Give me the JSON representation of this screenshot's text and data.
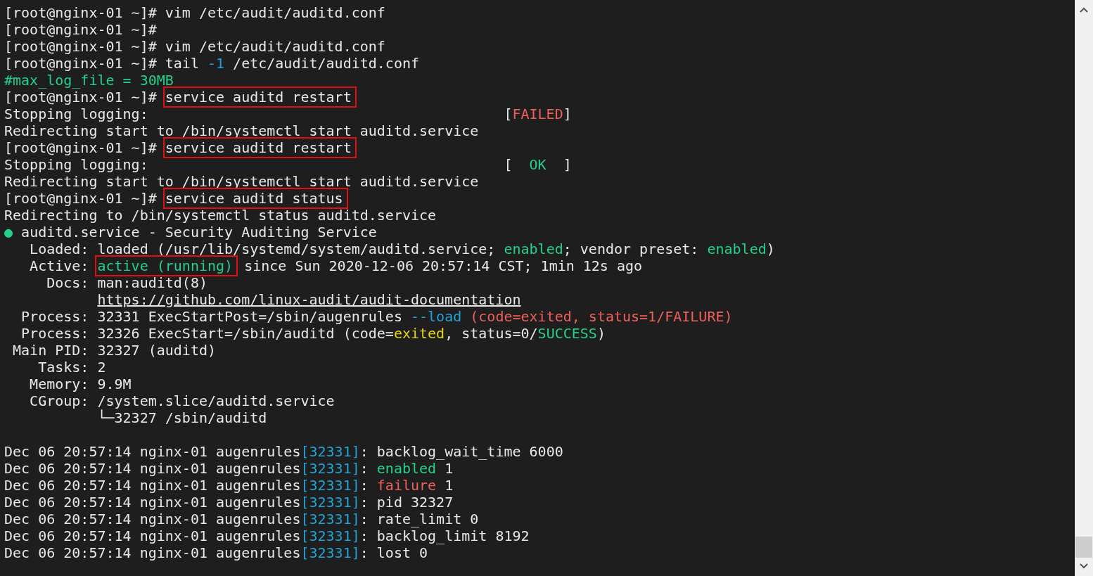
{
  "terminal": {
    "lines": [
      {
        "kind": "text",
        "segments": [
          {
            "text": "[root@nginx-01 ~]# vim /etc/audit/auditd.conf",
            "kind": "plain",
            "boxed": false
          }
        ]
      },
      {
        "kind": "text",
        "segments": [
          {
            "text": "[root@nginx-01 ~]#",
            "kind": "plain",
            "boxed": false
          }
        ]
      },
      {
        "kind": "text",
        "segments": [
          {
            "text": "[root@nginx-01 ~]# vim /etc/audit/auditd.conf",
            "kind": "plain",
            "boxed": false
          }
        ]
      },
      {
        "kind": "text",
        "segments": [
          {
            "text": "[root@nginx-01 ~]# tail ",
            "kind": "plain",
            "boxed": false
          },
          {
            "text": "-1",
            "kind": "option",
            "boxed": false
          },
          {
            "text": " /etc/audit/auditd.conf",
            "kind": "plain",
            "boxed": false
          }
        ]
      },
      {
        "kind": "text",
        "segments": [
          {
            "text": "#max_log_file = 30MB",
            "kind": "comment",
            "boxed": false
          }
        ]
      },
      {
        "kind": "text",
        "segments": [
          {
            "text": "[root@nginx-01 ~]# ",
            "kind": "plain",
            "boxed": false
          },
          {
            "text": "service auditd restart",
            "kind": "plain",
            "boxed": true
          }
        ]
      },
      {
        "kind": "status",
        "segments": [
          {
            "text": "Stopping logging:",
            "kind": "plain",
            "boxed": false
          }
        ],
        "status": {
          "open": "[",
          "label": "FAILED",
          "close": "]",
          "color": "#f0605a"
        }
      },
      {
        "kind": "text",
        "segments": [
          {
            "text": "Redirecting start to /bin/systemctl start auditd.service",
            "kind": "plain",
            "boxed": false
          }
        ]
      },
      {
        "kind": "text",
        "segments": [
          {
            "text": "[root@nginx-01 ~]# ",
            "kind": "plain",
            "boxed": false
          },
          {
            "text": "service auditd restart",
            "kind": "plain",
            "boxed": true
          }
        ]
      },
      {
        "kind": "status",
        "segments": [
          {
            "text": "Stopping logging:",
            "kind": "plain",
            "boxed": false
          }
        ],
        "status": {
          "open": "[",
          "label": "OK",
          "close": "]",
          "color": "#23d18b"
        }
      },
      {
        "kind": "text",
        "segments": [
          {
            "text": "Redirecting start to /bin/systemctl start auditd.service",
            "kind": "plain",
            "boxed": false
          }
        ]
      },
      {
        "kind": "text",
        "segments": [
          {
            "text": "[root@nginx-01 ~]# ",
            "kind": "plain",
            "boxed": false
          },
          {
            "text": "service auditd status",
            "kind": "plain",
            "boxed": true
          }
        ]
      },
      {
        "kind": "text",
        "segments": [
          {
            "text": "Redirecting to /bin/systemctl status auditd.service",
            "kind": "plain",
            "boxed": false
          }
        ]
      },
      {
        "kind": "text",
        "segments": [
          {
            "text": "●",
            "kind": "good",
            "boxed": false
          },
          {
            "text": " auditd.service - Security Auditing Service",
            "kind": "plain",
            "boxed": false
          }
        ]
      },
      {
        "kind": "text",
        "segments": [
          {
            "text": "   Loaded: loaded (/usr/lib/systemd/system/auditd.service; ",
            "kind": "plain",
            "boxed": false
          },
          {
            "text": "enabled",
            "kind": "good",
            "boxed": false
          },
          {
            "text": "; vendor preset: ",
            "kind": "plain",
            "boxed": false
          },
          {
            "text": "enabled",
            "kind": "good",
            "boxed": false
          },
          {
            "text": ")",
            "kind": "plain",
            "boxed": false
          }
        ]
      },
      {
        "kind": "text",
        "segments": [
          {
            "text": "   Active: ",
            "kind": "plain",
            "boxed": false
          },
          {
            "text": "active (running)",
            "kind": "good",
            "boxed": true
          },
          {
            "text": " since Sun 2020-12-06 20:57:14 CST; 1min 12s ago",
            "kind": "plain",
            "boxed": false
          }
        ]
      },
      {
        "kind": "text",
        "segments": [
          {
            "text": "     Docs: man:auditd(8)",
            "kind": "plain",
            "boxed": false
          }
        ]
      },
      {
        "kind": "continuation",
        "segments": [
          {
            "text": "https://github.com/linux-audit/audit-documentation",
            "kind": "link",
            "boxed": false
          }
        ]
      },
      {
        "kind": "text",
        "segments": [
          {
            "text": "  Process: 32331 ExecStartPost=/sbin/augenrules ",
            "kind": "plain",
            "boxed": false
          },
          {
            "text": "--load",
            "kind": "option",
            "boxed": false
          },
          {
            "text": " (code=exited, status=1/FAILURE)",
            "kind": "bad",
            "boxed": false
          }
        ]
      },
      {
        "kind": "text",
        "segments": [
          {
            "text": "  Process: 32326 ExecStart=/sbin/auditd (code=",
            "kind": "plain",
            "boxed": false
          },
          {
            "text": "exited",
            "kind": "warn",
            "boxed": false
          },
          {
            "text": ", status=0/",
            "kind": "plain",
            "boxed": false
          },
          {
            "text": "SUCCESS",
            "kind": "good",
            "boxed": false
          },
          {
            "text": ")",
            "kind": "plain",
            "boxed": false
          }
        ]
      },
      {
        "kind": "text",
        "segments": [
          {
            "text": " Main PID: 32327 (auditd)",
            "kind": "plain",
            "boxed": false
          }
        ]
      },
      {
        "kind": "text",
        "segments": [
          {
            "text": "    Tasks: 2",
            "kind": "plain",
            "boxed": false
          }
        ]
      },
      {
        "kind": "text",
        "segments": [
          {
            "text": "   Memory: 9.9M",
            "kind": "plain",
            "boxed": false
          }
        ]
      },
      {
        "kind": "text",
        "segments": [
          {
            "text": "   CGroup: /system.slice/auditd.service",
            "kind": "plain",
            "boxed": false
          }
        ]
      },
      {
        "kind": "text",
        "segments": [
          {
            "text": "           └─32327 /sbin/auditd",
            "kind": "plain",
            "boxed": false
          }
        ]
      },
      {
        "kind": "blank"
      },
      {
        "kind": "text",
        "segments": [
          {
            "text": "Dec 06 20:57:14 nginx-01 augenrules",
            "kind": "plain",
            "boxed": false
          },
          {
            "text": "[32331]",
            "kind": "option",
            "boxed": false
          },
          {
            "text": ": backlog_wait_time 6000",
            "kind": "plain",
            "boxed": false
          }
        ]
      },
      {
        "kind": "text",
        "segments": [
          {
            "text": "Dec 06 20:57:14 nginx-01 augenrules",
            "kind": "plain",
            "boxed": false
          },
          {
            "text": "[32331]",
            "kind": "option",
            "boxed": false
          },
          {
            "text": ": ",
            "kind": "plain",
            "boxed": false
          },
          {
            "text": "enabled",
            "kind": "good",
            "boxed": false
          },
          {
            "text": " 1",
            "kind": "plain",
            "boxed": false
          }
        ]
      },
      {
        "kind": "text",
        "segments": [
          {
            "text": "Dec 06 20:57:14 nginx-01 augenrules",
            "kind": "plain",
            "boxed": false
          },
          {
            "text": "[32331]",
            "kind": "option",
            "boxed": false
          },
          {
            "text": ": ",
            "kind": "plain",
            "boxed": false
          },
          {
            "text": "failure",
            "kind": "bad",
            "boxed": false
          },
          {
            "text": " 1",
            "kind": "plain",
            "boxed": false
          }
        ]
      },
      {
        "kind": "text",
        "segments": [
          {
            "text": "Dec 06 20:57:14 nginx-01 augenrules",
            "kind": "plain",
            "boxed": false
          },
          {
            "text": "[32331]",
            "kind": "option",
            "boxed": false
          },
          {
            "text": ": pid 32327",
            "kind": "plain",
            "boxed": false
          }
        ]
      },
      {
        "kind": "text",
        "segments": [
          {
            "text": "Dec 06 20:57:14 nginx-01 augenrules",
            "kind": "plain",
            "boxed": false
          },
          {
            "text": "[32331]",
            "kind": "option",
            "boxed": false
          },
          {
            "text": ": rate_limit 0",
            "kind": "plain",
            "boxed": false
          }
        ]
      },
      {
        "kind": "text",
        "segments": [
          {
            "text": "Dec 06 20:57:14 nginx-01 augenrules",
            "kind": "plain",
            "boxed": false
          },
          {
            "text": "[32331]",
            "kind": "option",
            "boxed": false
          },
          {
            "text": ": backlog_limit 8192",
            "kind": "plain",
            "boxed": false
          }
        ]
      },
      {
        "kind": "text",
        "segments": [
          {
            "text": "Dec 06 20:57:14 nginx-01 augenrules",
            "kind": "plain",
            "boxed": false
          },
          {
            "text": "[32331]",
            "kind": "option",
            "boxed": false
          },
          {
            "text": ": lost 0",
            "kind": "plain",
            "boxed": false
          }
        ]
      }
    ]
  }
}
